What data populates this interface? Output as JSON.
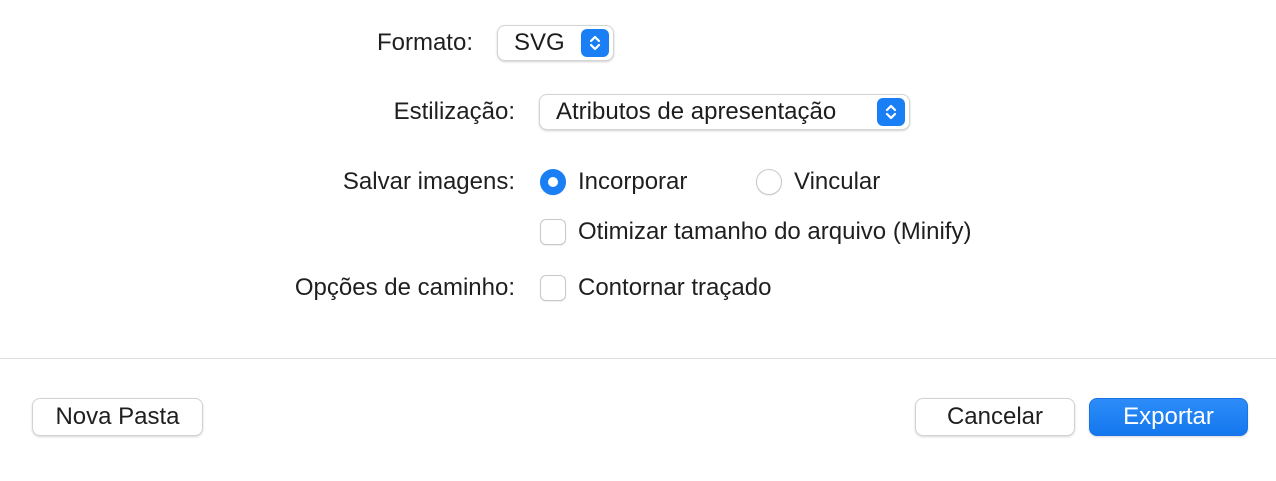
{
  "form": {
    "format": {
      "label": "Formato:",
      "value": "SVG"
    },
    "styling": {
      "label": "Estilização:",
      "value": "Atributos de apresentação"
    },
    "save_images": {
      "label": "Salvar imagens:",
      "options": [
        {
          "label": "Incorporar",
          "selected": true
        },
        {
          "label": "Vincular",
          "selected": false
        }
      ]
    },
    "minify": {
      "label": "Otimizar tamanho do arquivo (Minify)",
      "checked": false
    },
    "path_options": {
      "label": "Opções de caminho:",
      "outline_stroke": {
        "label": "Contornar traçado",
        "checked": false
      }
    }
  },
  "footer": {
    "new_folder_label": "Nova Pasta",
    "cancel_label": "Cancelar",
    "export_label": "Exportar"
  },
  "colors": {
    "accent": "#1a7ff5"
  }
}
